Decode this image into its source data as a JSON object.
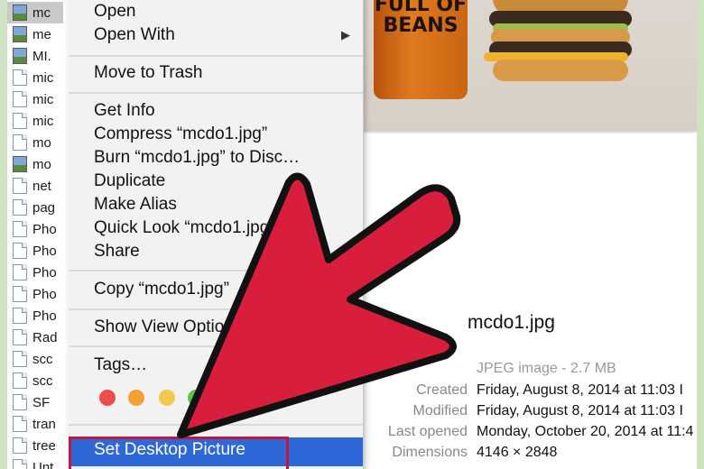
{
  "file_list": [
    {
      "name": "mc",
      "icon": "image-icon",
      "selected": true
    },
    {
      "name": "me",
      "icon": "image-icon"
    },
    {
      "name": "MI.",
      "icon": "image-icon"
    },
    {
      "name": "mic",
      "icon": "document-icon"
    },
    {
      "name": "mic",
      "icon": "document-icon"
    },
    {
      "name": "mic",
      "icon": "document-icon"
    },
    {
      "name": "mo",
      "icon": "document-icon"
    },
    {
      "name": "mo",
      "icon": "image-icon"
    },
    {
      "name": "net",
      "icon": "document-icon"
    },
    {
      "name": "pag",
      "icon": "document-icon"
    },
    {
      "name": "Pho",
      "icon": "document-icon"
    },
    {
      "name": "Pho",
      "icon": "document-icon"
    },
    {
      "name": "Pho",
      "icon": "document-icon"
    },
    {
      "name": "Pho",
      "icon": "document-icon"
    },
    {
      "name": "Pho",
      "icon": "document-icon"
    },
    {
      "name": "Rad",
      "icon": "document-icon"
    },
    {
      "name": "scc",
      "icon": "document-icon"
    },
    {
      "name": "scc",
      "icon": "document-icon"
    },
    {
      "name": "SF",
      "icon": "document-icon"
    },
    {
      "name": "tran",
      "icon": "document-icon"
    },
    {
      "name": "tree",
      "icon": "document-icon"
    },
    {
      "name": "Unt",
      "icon": "document-icon"
    }
  ],
  "context_menu": {
    "open": "Open",
    "open_with": "Open With",
    "move_to_trash": "Move to Trash",
    "get_info": "Get Info",
    "compress": "Compress “mcdo1.jpg”",
    "burn": "Burn “mcdo1.jpg” to Disc…",
    "duplicate": "Duplicate",
    "make_alias": "Make Alias",
    "quick_look": "Quick Look “mcdo1.jpg”",
    "share": "Share",
    "copy": "Copy “mcdo1.jpg”",
    "show_view_options": "Show View Options",
    "tags": "Tags…",
    "set_desktop_picture": "Set Desktop Picture",
    "tag_colors": [
      "#ee4b4b",
      "#f5a035",
      "#f2c94c",
      "#5dc24a"
    ],
    "submenu_arrow": "▶"
  },
  "preview": {
    "cup_text": "FULL OF BEANS",
    "filename": "mcdo1.jpg",
    "kind": "JPEG image - 2.7 MB",
    "metadata": [
      {
        "label": "Created",
        "value": "Friday, August 8, 2014 at 11:03 I"
      },
      {
        "label": "Modified",
        "value": "Friday, August 8, 2014 at 11:03 I"
      },
      {
        "label": "Last opened",
        "value": "Monday, October 20, 2014 at 11:4"
      },
      {
        "label": "Dimensions",
        "value": "4146 × 2848"
      }
    ]
  },
  "colors": {
    "frame": "#cfe3c2",
    "selection": "#2e67d6",
    "highlight_outline": "#c0183c",
    "arrow_fill": "#d81e3c"
  }
}
